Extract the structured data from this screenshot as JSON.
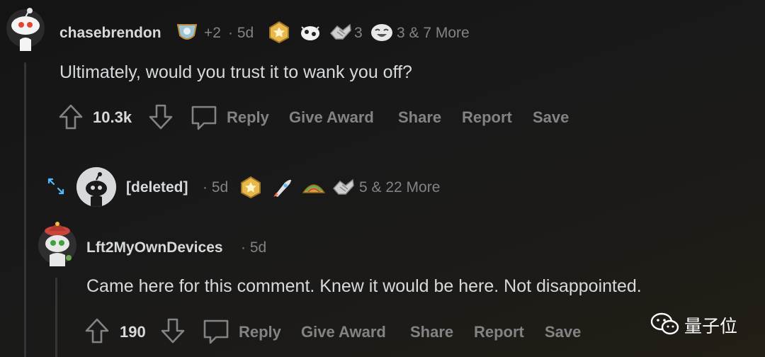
{
  "comment1": {
    "username": "chasebrendon",
    "award_extra": "+2",
    "time": "· 5d",
    "award_count_a": "3",
    "more_awards": "3 & 7 More",
    "body": "Ultimately, would you trust it to wank you off?",
    "score": "10.3k",
    "actions": {
      "reply": "Reply",
      "give_award": "Give Award",
      "share": "Share",
      "report": "Report",
      "save": "Save"
    }
  },
  "comment2": {
    "username": "[deleted]",
    "time": "· 5d",
    "more_awards": "5 & 22 More"
  },
  "comment3": {
    "username": "Lft2MyOwnDevices",
    "time": "· 5d",
    "body": "Came here for this comment. Knew it would be here. Not disappointed.",
    "score": "190",
    "actions": {
      "reply": "Reply",
      "give_award": "Give Award",
      "share": "Share",
      "report": "Report",
      "save": "Save"
    }
  },
  "watermark": {
    "text": "量子位"
  },
  "colors": {
    "background": "#1a1a1b",
    "text": "#d7dadc",
    "muted": "#818384",
    "line": "#343536",
    "award_gold": "#e8b84a"
  }
}
